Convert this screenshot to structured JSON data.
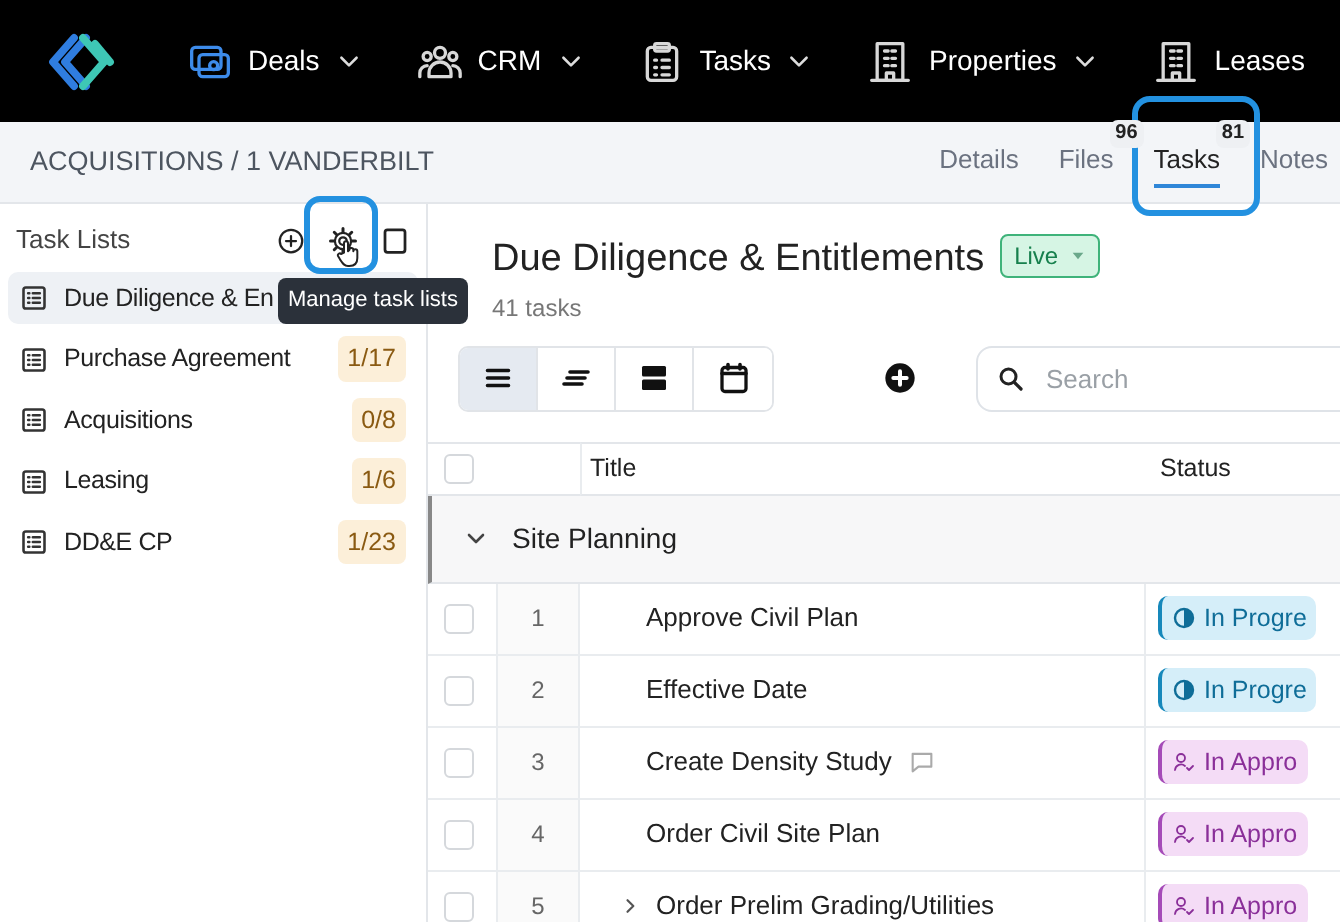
{
  "nav": {
    "items": [
      {
        "label": "Deals",
        "active": true
      },
      {
        "label": "CRM",
        "active": false
      },
      {
        "label": "Tasks",
        "active": false
      },
      {
        "label": "Properties",
        "active": false
      },
      {
        "label": "Leases",
        "active": false
      }
    ]
  },
  "breadcrumb": "ACQUISITIONS / 1 VANDERBILT",
  "tabs": [
    {
      "label": "Details",
      "selected": false,
      "highlighted": false
    },
    {
      "label": "Files",
      "badge": "96",
      "selected": false,
      "highlighted": false
    },
    {
      "label": "Tasks",
      "badge": "81",
      "selected": true,
      "highlighted": true
    },
    {
      "label": "Notes",
      "selected": false,
      "highlighted": false
    }
  ],
  "sidebar": {
    "title": "Task Lists",
    "tools": [
      {
        "kind": "add",
        "highlighted": false
      },
      {
        "kind": "settings",
        "highlighted": true
      },
      {
        "kind": "panel",
        "highlighted": false
      }
    ],
    "tooltip": "Manage task lists",
    "task_lists": [
      {
        "name": "Due Diligence & En",
        "selected": true
      },
      {
        "name": "Purchase Agreement",
        "count": "1/17",
        "selected": false
      },
      {
        "name": "Acquisitions",
        "count": "0/8",
        "selected": false
      },
      {
        "name": "Leasing",
        "count": "1/6",
        "selected": false
      },
      {
        "name": "DD&E CP",
        "count": "1/23",
        "selected": false
      }
    ]
  },
  "main": {
    "title": "Due Diligence & Entitlements",
    "status": "Live",
    "subtitle": "41 tasks",
    "view_buttons": [
      {
        "kind": "list",
        "selected": true
      },
      {
        "kind": "compact",
        "selected": false
      },
      {
        "kind": "cards",
        "selected": false
      },
      {
        "kind": "calendar",
        "selected": false
      }
    ],
    "search": {
      "placeholder": "Search"
    },
    "select_all": {
      "checked": false
    },
    "columns": [
      "Title",
      "Status"
    ],
    "group": {
      "name": "Site Planning",
      "expanded": true
    },
    "rows": [
      {
        "checked": false,
        "number": "1",
        "title": "Approve Civil Plan",
        "comment": false,
        "has_children": false,
        "status": {
          "label": "In Progre",
          "kind": "progress"
        }
      },
      {
        "checked": false,
        "number": "2",
        "title": "Effective Date",
        "comment": false,
        "has_children": false,
        "status": {
          "label": "In Progre",
          "kind": "progress"
        }
      },
      {
        "checked": false,
        "number": "3",
        "title": "Create Density Study",
        "comment": true,
        "has_children": false,
        "status": {
          "label": "In Appro",
          "kind": "approval"
        }
      },
      {
        "checked": false,
        "number": "4",
        "title": "Order Civil Site Plan",
        "comment": false,
        "has_children": false,
        "status": {
          "label": "In Appro",
          "kind": "approval"
        }
      },
      {
        "checked": false,
        "number": "5",
        "title": "Order Prelim Grading/Utilities",
        "comment": false,
        "has_children": true,
        "status": {
          "label": "In Appro",
          "kind": "approval"
        }
      }
    ]
  }
}
